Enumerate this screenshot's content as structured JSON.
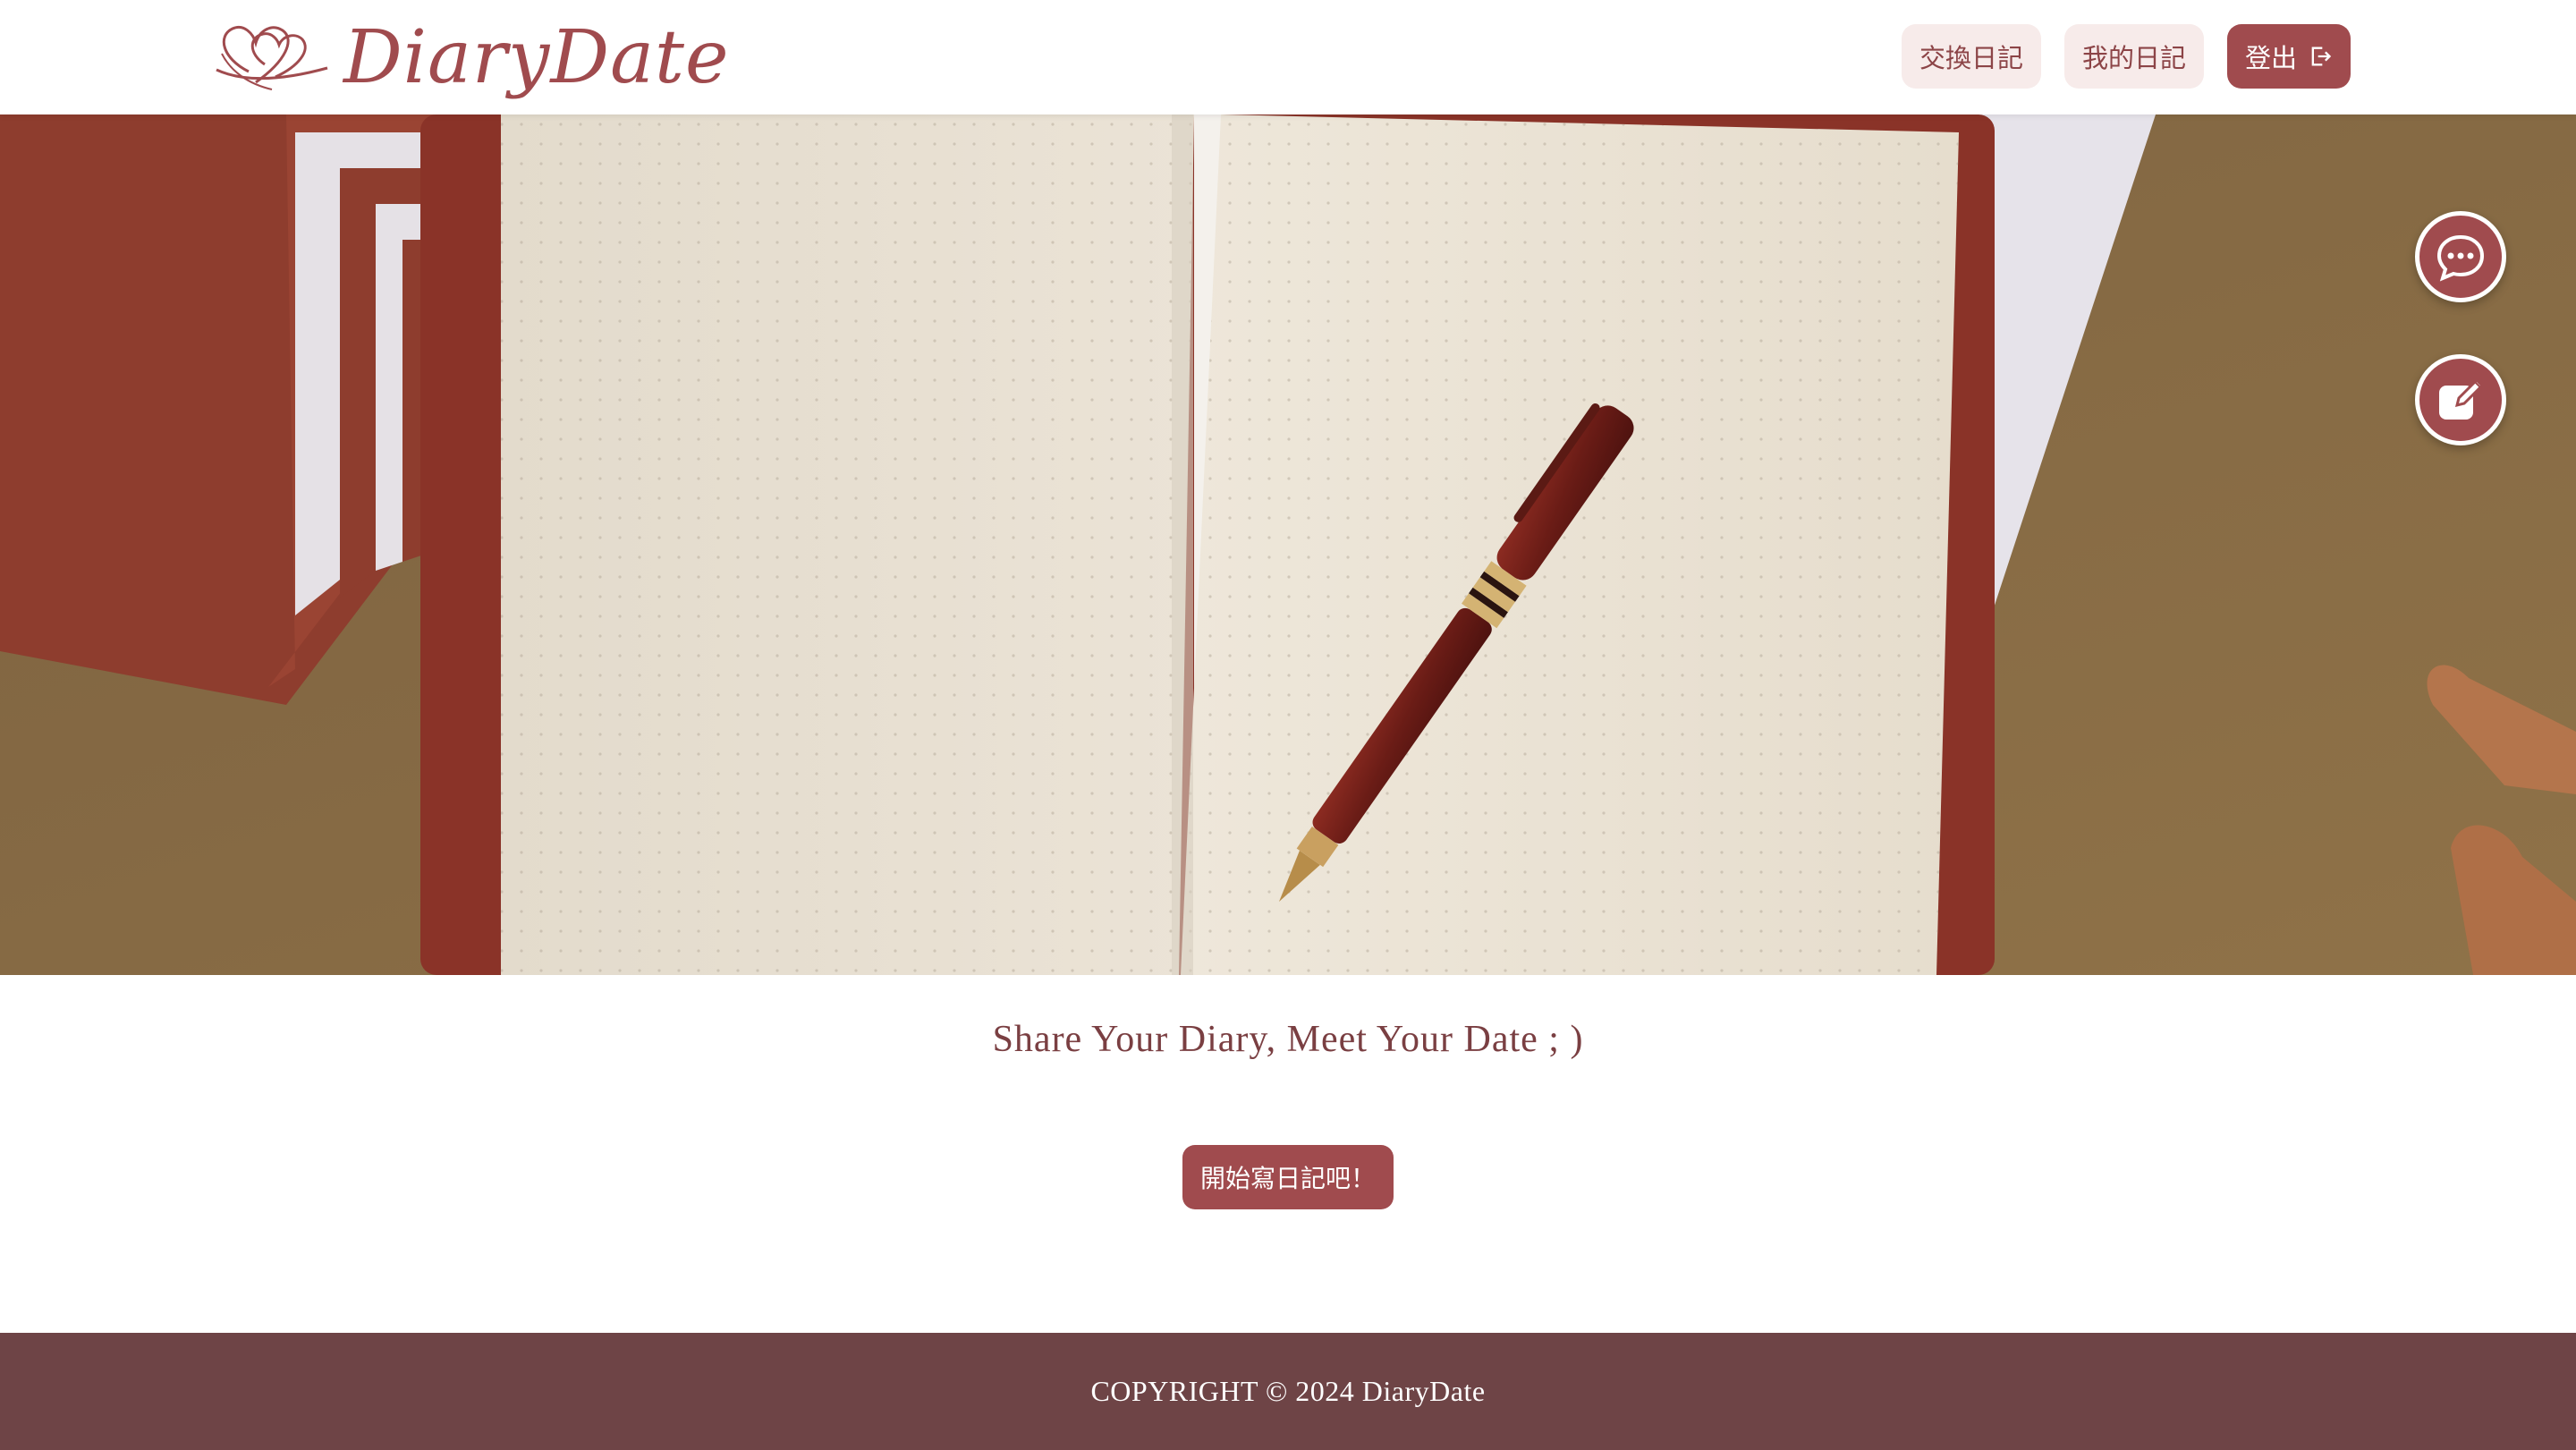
{
  "brand": {
    "name": "DiaryDate"
  },
  "nav": {
    "items": [
      {
        "label": "交換日記"
      },
      {
        "label": "我的日記"
      }
    ],
    "logout_label": "登出"
  },
  "hero": {
    "image": "open-notebook-with-pen-photo"
  },
  "floating_actions": {
    "chat_icon": "chat-bubble-icon",
    "write_icon": "edit-note-icon"
  },
  "main": {
    "tagline": "Share Your Diary, Meet Your Date ; )",
    "cta_label": "開始寫日記吧！"
  },
  "footer": {
    "copyright": "COPYRIGHT © 2024 DiaryDate"
  },
  "colors": {
    "brand": "#a04b4e",
    "nav_button_bg": "#f7ebea",
    "footer_bg": "#6e4446",
    "tagline": "#7a3f42"
  }
}
